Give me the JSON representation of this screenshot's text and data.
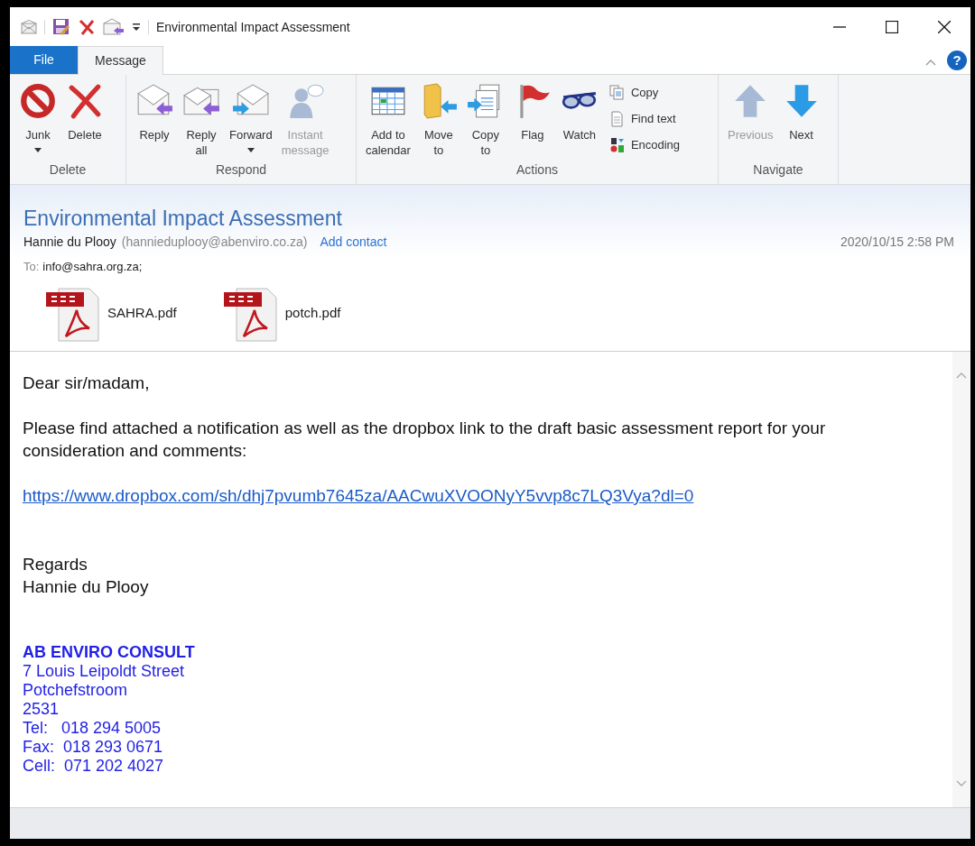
{
  "window": {
    "title": "Environmental Impact Assessment"
  },
  "tabs": [
    {
      "label": "File",
      "kind": "file",
      "selected": false
    },
    {
      "label": "Message",
      "kind": "tab",
      "selected": true
    }
  ],
  "help": "?",
  "ribbon": {
    "groups": [
      {
        "label": "Delete",
        "buttons": [
          {
            "label": "Junk",
            "kind": "large",
            "disabled": false,
            "dropdown": true
          },
          {
            "label": "Delete",
            "kind": "large",
            "disabled": false,
            "dropdown": false
          }
        ]
      },
      {
        "label": "Respond",
        "buttons": [
          {
            "label": "Reply",
            "kind": "large",
            "disabled": false,
            "dropdown": false
          },
          {
            "label": "Reply all",
            "kind": "large",
            "disabled": false,
            "dropdown": false
          },
          {
            "label": "Forward",
            "kind": "large",
            "disabled": false,
            "dropdown": true
          },
          {
            "label": "Instant message",
            "kind": "large",
            "disabled": true,
            "dropdown": false
          }
        ]
      },
      {
        "label": "Actions",
        "buttons": [
          {
            "label": "Add to calendar",
            "kind": "large",
            "disabled": false,
            "dropdown": false
          },
          {
            "label": "Move to",
            "kind": "large",
            "disabled": false,
            "dropdown": false
          },
          {
            "label": "Copy to",
            "kind": "large",
            "disabled": false,
            "dropdown": false
          },
          {
            "label": "Flag",
            "kind": "large",
            "disabled": false,
            "dropdown": false
          },
          {
            "label": "Watch",
            "kind": "large",
            "disabled": false,
            "dropdown": false
          },
          {
            "label": "Copy",
            "kind": "small",
            "disabled": false
          },
          {
            "label": "Find text",
            "kind": "small",
            "disabled": false
          },
          {
            "label": "Encoding",
            "kind": "small",
            "disabled": false
          }
        ]
      },
      {
        "label": "Navigate",
        "buttons": [
          {
            "label": "Previous",
            "kind": "large",
            "disabled": true,
            "dropdown": false
          },
          {
            "label": "Next",
            "kind": "large",
            "disabled": false,
            "dropdown": false
          }
        ]
      }
    ]
  },
  "message": {
    "subject": "Environmental Impact Assessment",
    "sender_name": "Hannie du Plooy",
    "sender_email": "(hannieduplooy@abenviro.co.za)",
    "add_contact": "Add contact",
    "date": "2020/10/15 2:58 PM",
    "to_label": "To:",
    "to": "info@sahra.org.za;",
    "attachments": [
      {
        "name": "SAHRA.pdf"
      },
      {
        "name": "potch.pdf"
      }
    ],
    "body": [
      {
        "kind": "text",
        "lines": [
          "Dear sir/madam,"
        ]
      },
      {
        "kind": "text",
        "lines": [
          "Please find attached a notification as well as the dropbox link to the draft basic assessment report for your",
          "consideration and comments:"
        ]
      },
      {
        "kind": "link",
        "lines": [
          "https://www.dropbox.com/sh/dhj7pvumb7645za/AACwuXVOONyY5vvp8c7LQ3Vya?dl=0"
        ]
      },
      {
        "kind": "text",
        "lines": [
          "Regards",
          "Hannie du Plooy"
        ]
      },
      {
        "kind": "signature",
        "lines": [
          "AB ENVIRO CONSULT",
          "7 Louis Leipoldt Street",
          "Potchefstroom",
          "2531",
          "Tel:   018 294 5005",
          "Fax:  018 293 0671",
          "Cell:  071 202 4027"
        ]
      }
    ]
  }
}
